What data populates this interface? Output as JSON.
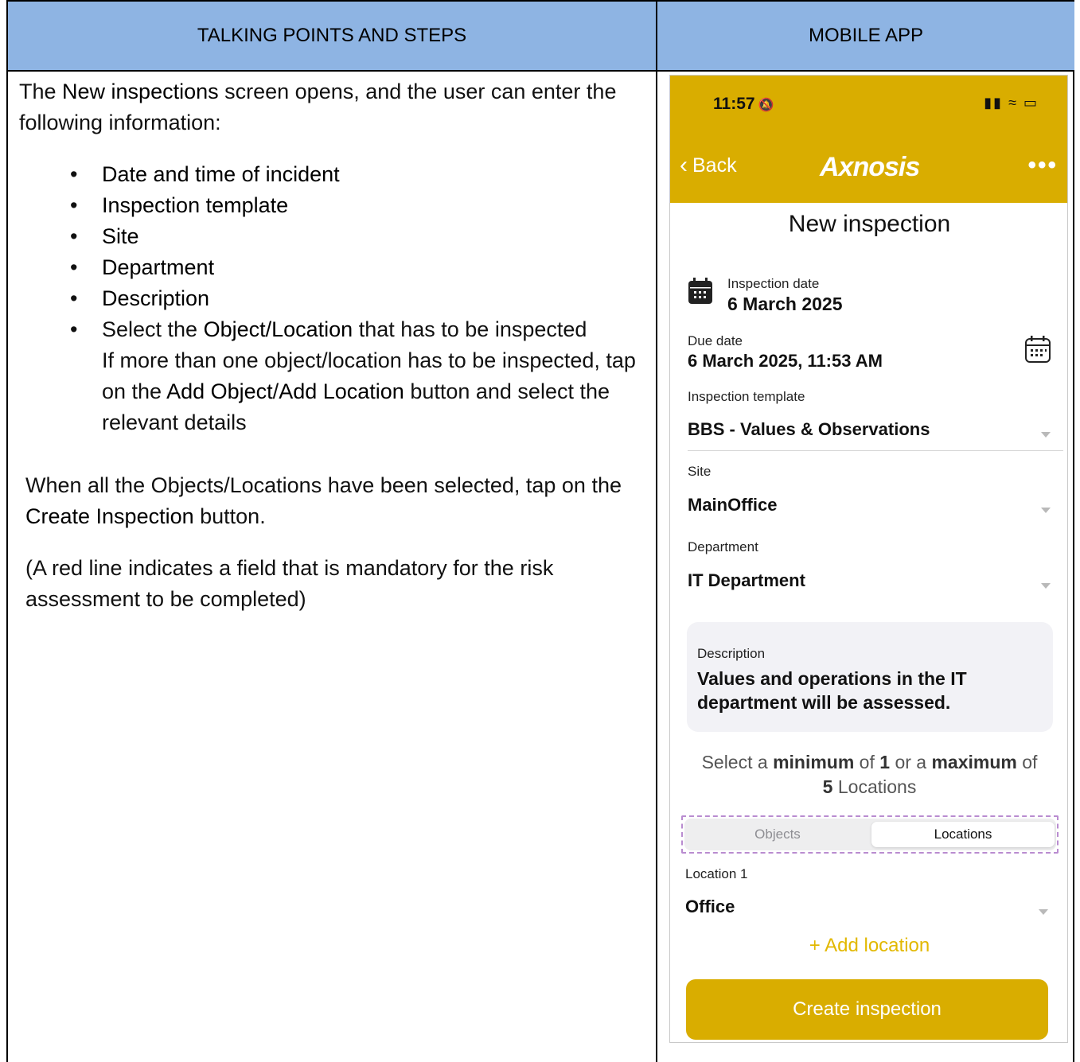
{
  "table": {
    "header_left": "TALKING POINTS AND STEPS",
    "header_right": "MOBILE APP"
  },
  "left": {
    "intro_pre": "The ",
    "intro_bold": "New inspections",
    "intro_post": " screen opens, and the user can enter the following information:",
    "bullets": [
      "Date and time of incident",
      "Inspection template",
      "Site",
      "Department",
      "Description"
    ],
    "last_bullet": {
      "pre": "Select the ",
      "bold": "Object/Location",
      "post": " that has to be inspected",
      "line2": "If more than one object/location has to be inspected, tap on the ",
      "bold2": "Add Object",
      "slash": "/",
      "bold3": "Add Location",
      "post2": " button and select the relevant details"
    },
    "para1_pre": "When all the Objects/Locations have been selected, tap on the ",
    "para1_bold": "Create Inspection",
    "para1_post": " button.",
    "para2": "(A red line indicates a field that is mandatory for the risk assessment to be completed)"
  },
  "app": {
    "status_time": "11:57",
    "back_label": "Back",
    "logo_text": "Axnosis",
    "title": "New inspection",
    "inspection_date_label": "Inspection date",
    "inspection_date_value": "6 March 2025",
    "due_date_label": "Due date",
    "due_date_value": "6 March 2025, 11:53 AM",
    "template_label": "Inspection template",
    "template_value": "BBS - Values & Observations",
    "site_label": "Site",
    "site_value": "MainOffice",
    "department_label": "Department",
    "department_value": "IT Department",
    "description_label": "Description",
    "description_value": "Values and operations in the IT department will be assessed.",
    "hint": {
      "t1": "Select a ",
      "b1": "minimum",
      "t2": " of ",
      "b2": "1",
      "t3": " or a ",
      "b3": "maximum",
      "t4": " of ",
      "b4": "5",
      "t5": " Locations"
    },
    "segments": [
      "Objects",
      "Locations"
    ],
    "selected_segment": "Locations",
    "location_label": "Location 1",
    "location_value": "Office",
    "add_location_label": "+ Add location",
    "create_button_label": "Create inspection",
    "colors": {
      "brand_yellow": "#d9ad00",
      "accent_yellow": "#e2b800",
      "header_blue": "#8eb4e3"
    },
    "icons": [
      "bell-slash-icon",
      "signal-icon",
      "wifi-icon",
      "battery-icon",
      "chevron-left-icon",
      "more-icon",
      "calendar-icon",
      "chevron-down-icon"
    ]
  }
}
